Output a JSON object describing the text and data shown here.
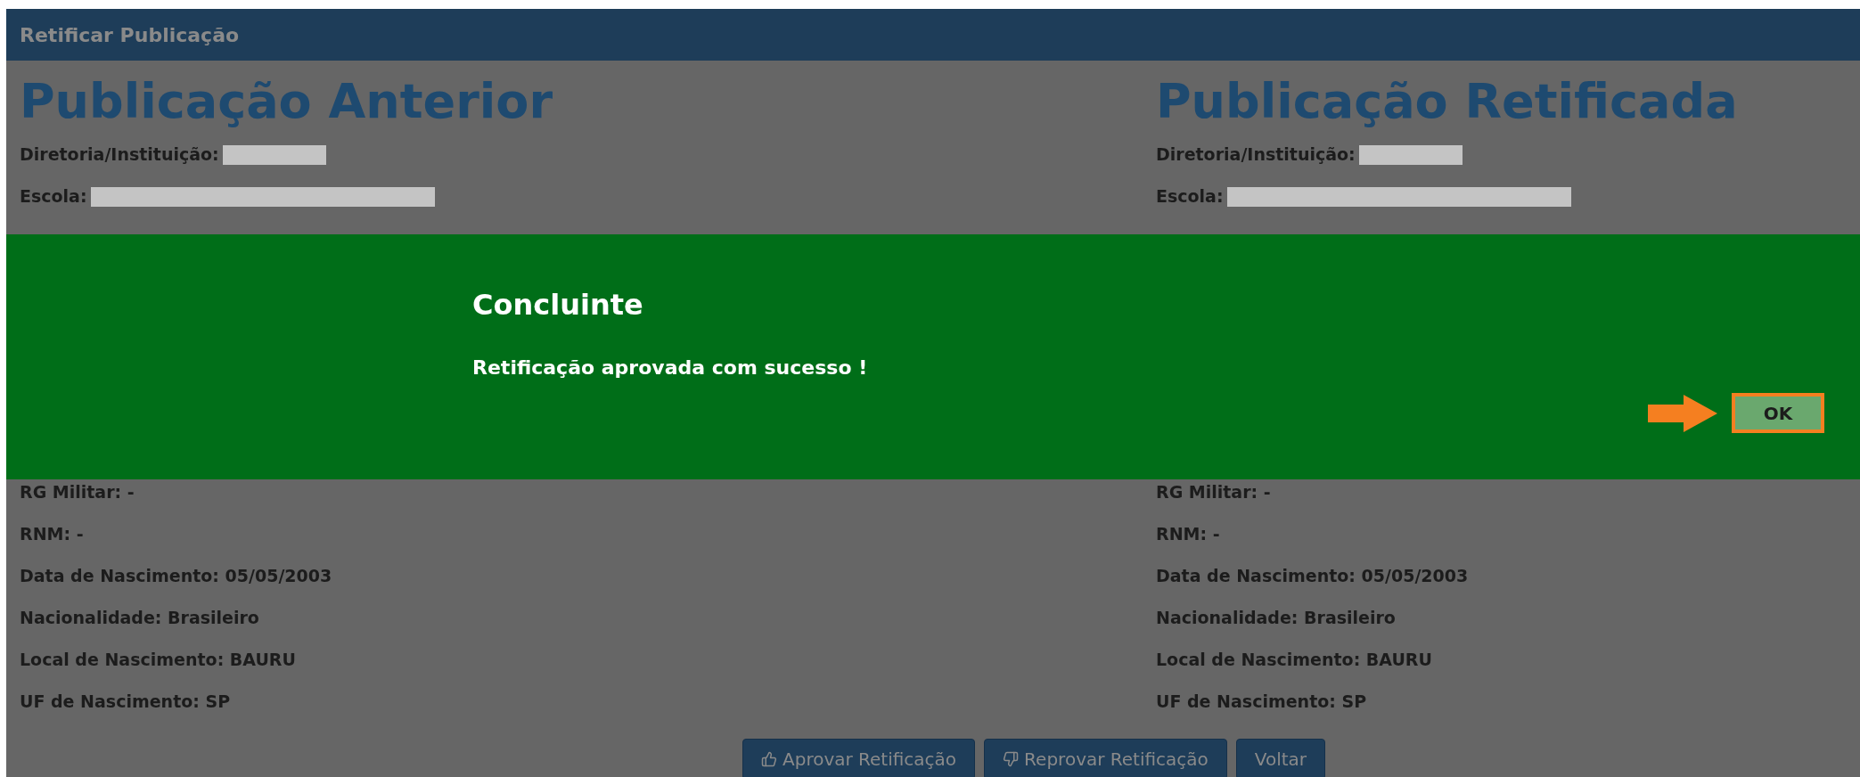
{
  "header": {
    "title": "Retificar Publicação"
  },
  "columns": [
    {
      "heading": "Publicação Anterior",
      "upper_fields": [
        {
          "label": "Diretoria/Instituição:",
          "kind": "redacted"
        },
        {
          "label": "Escola:",
          "kind": "redacted_wide"
        }
      ],
      "lower_fields": [
        {
          "label": "RG Militar: -"
        },
        {
          "label": "RNM: -"
        },
        {
          "label": "Data de Nascimento: 05/05/2003"
        },
        {
          "label": "Nacionalidade: Brasileiro"
        },
        {
          "label": "Local de Nascimento: BAURU"
        },
        {
          "label": "UF de Nascimento: SP"
        }
      ]
    },
    {
      "heading": "Publicação Retificada",
      "upper_fields": [
        {
          "label": "Diretoria/Instituição:",
          "kind": "redacted"
        },
        {
          "label": "Escola:",
          "kind": "redacted_wide"
        }
      ],
      "lower_fields": [
        {
          "label": "RG Militar: -"
        },
        {
          "label": "RNM: -"
        },
        {
          "label": "Data de Nascimento: 05/05/2003"
        },
        {
          "label": "Nacionalidade: Brasileiro"
        },
        {
          "label": "Local de Nascimento: BAURU"
        },
        {
          "label": "UF de Nascimento: SP"
        }
      ]
    }
  ],
  "buttons": [
    {
      "label": "Aprovar Retificação",
      "kind": "approve"
    },
    {
      "label": "Reprovar Retificação",
      "kind": "reject"
    },
    {
      "label": "Voltar",
      "kind": "plain"
    }
  ],
  "dialog": {
    "title": "Concluinte",
    "message": "Retificação aprovada com sucesso !",
    "ok_button": "OK"
  }
}
